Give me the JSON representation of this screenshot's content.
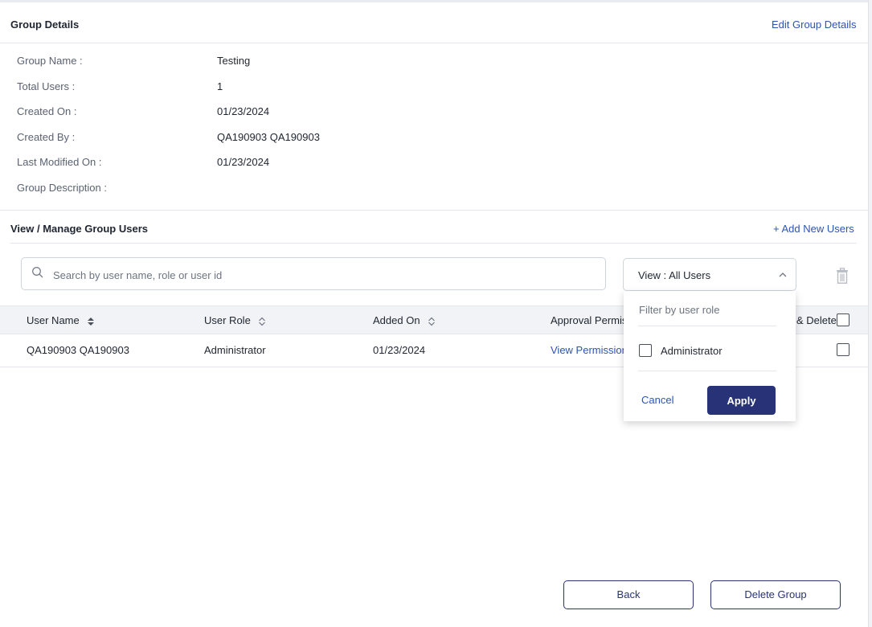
{
  "group_details": {
    "title": "Group Details",
    "edit_link": "Edit Group Details",
    "fields": [
      {
        "label": "Group Name :",
        "value": "Testing"
      },
      {
        "label": "Total Users :",
        "value": "1"
      },
      {
        "label": "Created On :",
        "value": "01/23/2024"
      },
      {
        "label": "Created By :",
        "value": "QA190903 QA190903"
      },
      {
        "label": "Last Modified On :",
        "value": "01/23/2024"
      },
      {
        "label": "Group Description :",
        "value": ""
      }
    ]
  },
  "manage": {
    "title": "View / Manage Group Users",
    "add_link": "+ Add New Users",
    "search_placeholder": "Search by user name, role or user id",
    "view_label": "View :",
    "view_value": "All Users"
  },
  "table": {
    "columns": [
      "User Name",
      "User Role",
      "Added On",
      "Approval Permis",
      "& Delete"
    ],
    "rows": [
      {
        "user_name": "QA190903 QA190903",
        "user_role": "Administrator",
        "added_on": "01/23/2024",
        "permissions_link": "View Permission"
      }
    ]
  },
  "filter_popup": {
    "placeholder": "Filter by user role",
    "option": "Administrator",
    "cancel_label": "Cancel",
    "apply_label": "Apply"
  },
  "footer": {
    "back_label": "Back",
    "delete_group_label": "Delete Group"
  },
  "colors": {
    "accent": "#273376",
    "link": "#2c54b0"
  }
}
